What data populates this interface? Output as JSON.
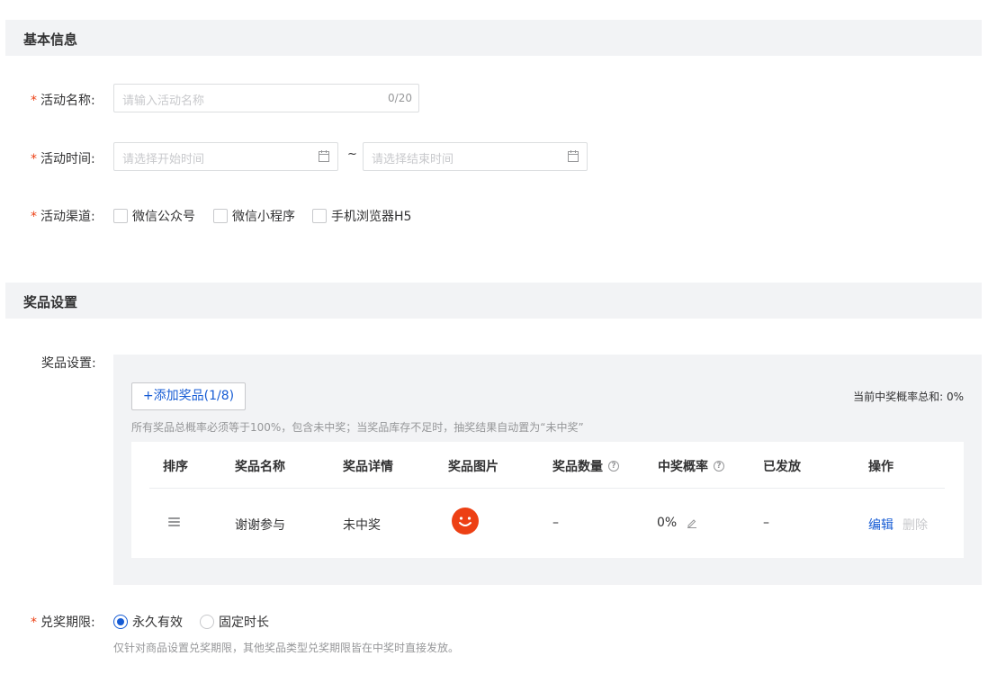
{
  "basic": {
    "header": "基本信息",
    "name_label": "活动名称:",
    "name_placeholder": "请输入活动名称",
    "name_count": "0/20",
    "time_label": "活动时间:",
    "start_placeholder": "请选择开始时间",
    "end_placeholder": "请选择结束时间",
    "separator": "~",
    "channel_label": "活动渠道:",
    "channels": [
      "微信公众号",
      "微信小程序",
      "手机浏览器H5"
    ]
  },
  "prize": {
    "header": "奖品设置",
    "label": "奖品设置:",
    "add_button": "+添加奖品(1/8)",
    "prob_sum": "当前中奖概率总和: 0%",
    "hint": "所有奖品总概率必须等于100%，包含未中奖；当奖品库存不足时，抽奖结果自动置为“未中奖”",
    "columns": [
      "排序",
      "奖品名称",
      "奖品详情",
      "奖品图片",
      "奖品数量",
      "中奖概率",
      "已发放",
      "操作"
    ],
    "row": {
      "name": "谢谢参与",
      "detail": "未中奖",
      "quantity": "–",
      "probability": "0%",
      "issued": "–",
      "edit": "编辑",
      "delete": "删除"
    }
  },
  "redeem": {
    "label": "兑奖期限:",
    "option_permanent": "永久有效",
    "option_fixed": "固定时长",
    "selected": "永久有效",
    "hint": "仅针对商品设置兑奖期限，其他奖品类型兑奖期限皆在中奖时直接发放。"
  },
  "colors": {
    "accent": "#155bd4",
    "required": "#ed4014",
    "smile": "#ed4014"
  }
}
